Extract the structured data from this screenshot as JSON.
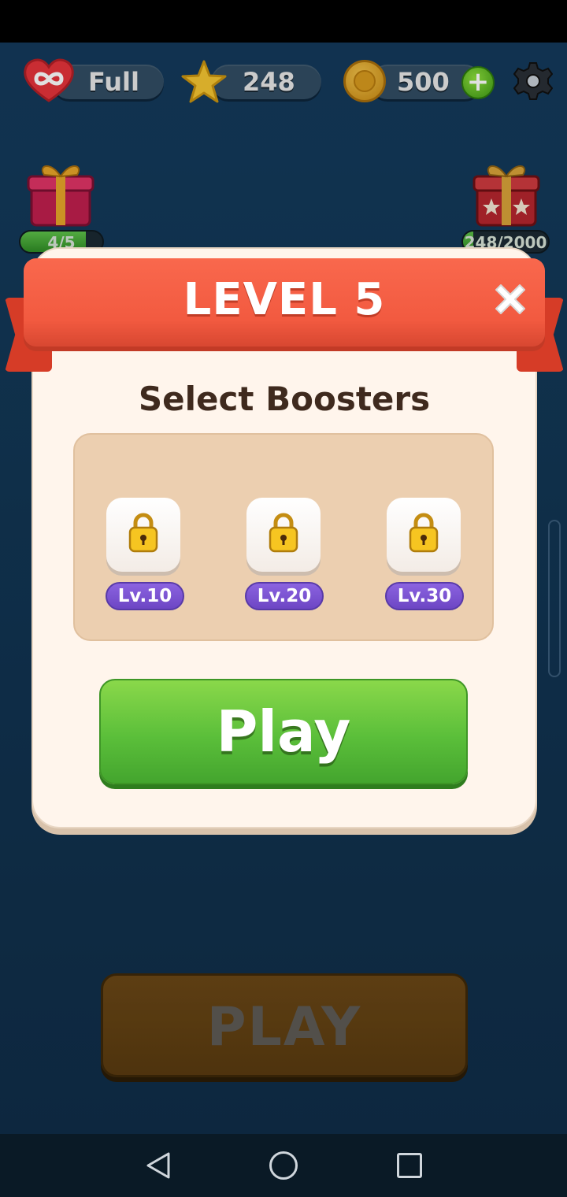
{
  "hud": {
    "lives_label": "Full",
    "stars_count": "248",
    "coins_count": "500",
    "plus_symbol": "+"
  },
  "rewards": {
    "left_progress": "4/5",
    "left_fraction": 0.8,
    "right_progress": "248/2000",
    "right_fraction": 0.124
  },
  "modal": {
    "title": "LEVEL 5",
    "section_title": "Select Boosters",
    "boosters": [
      {
        "level": "Lv.10",
        "locked": true
      },
      {
        "level": "Lv.20",
        "locked": true
      },
      {
        "level": "Lv.30",
        "locked": true
      }
    ],
    "play_label": "Play"
  },
  "background": {
    "play_label": "PLAY"
  },
  "colors": {
    "ribbon": "#f25a40",
    "play_green": "#5bbf3a",
    "badge_purple": "#7a52d6",
    "panel_tan": "#eccfb0"
  },
  "icons": [
    "heart-infinity-icon",
    "star-icon",
    "coin-icon",
    "plus-icon",
    "gear-icon",
    "gift-icon",
    "close-icon",
    "lock-icon",
    "nav-back-icon",
    "nav-home-icon",
    "nav-recents-icon"
  ]
}
